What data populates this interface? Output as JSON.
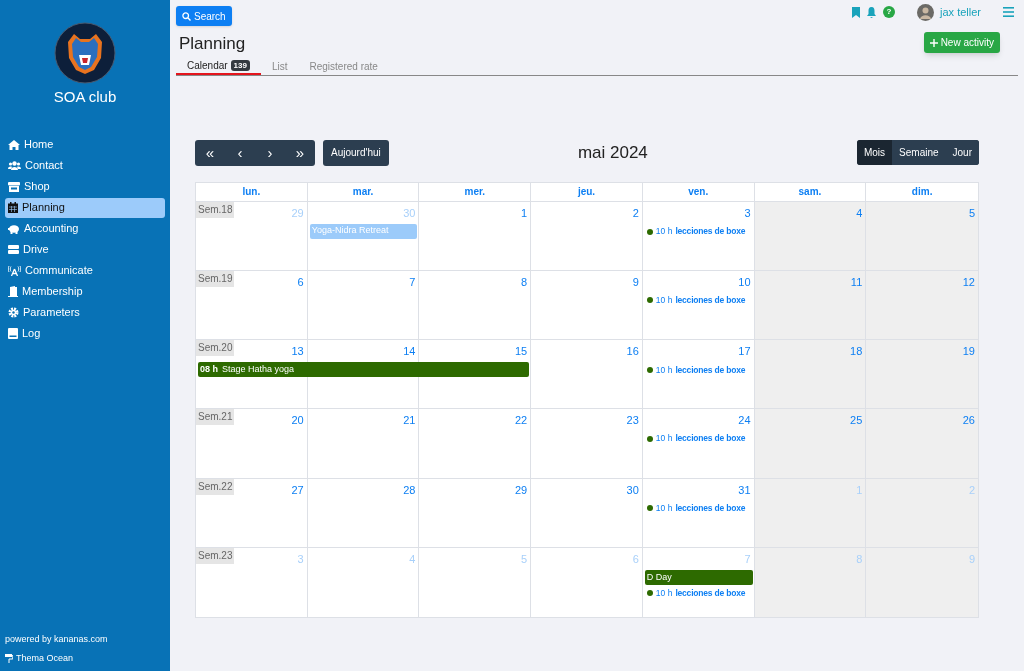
{
  "sidebar": {
    "club_name": "SOA club",
    "items": [
      {
        "label": "Home",
        "selected": false
      },
      {
        "label": "Contact",
        "selected": false
      },
      {
        "label": "Shop",
        "selected": false
      },
      {
        "label": "Planning",
        "selected": true
      },
      {
        "label": "Accounting",
        "selected": false
      },
      {
        "label": "Drive",
        "selected": false
      },
      {
        "label": "Communicate",
        "selected": false
      },
      {
        "label": "Membership",
        "selected": false
      },
      {
        "label": "Parameters",
        "selected": false
      },
      {
        "label": "Log",
        "selected": false
      }
    ],
    "powered_by": "powered by kananas.com",
    "theme": "Thema Ocean"
  },
  "topbar": {
    "search_label": "Search",
    "user_name": "jax teller",
    "help": "?"
  },
  "page_title": "Planning",
  "new_activity_label": "New activity",
  "tabs": [
    {
      "label": "Calendar",
      "badge": "139",
      "selected": true
    },
    {
      "label": "List",
      "selected": false
    },
    {
      "label": "Registered rate",
      "selected": false
    }
  ],
  "calendar": {
    "nav_buttons": [
      "«",
      "‹",
      "›",
      "»"
    ],
    "today_label": "Aujourd'hui",
    "title": "mai 2024",
    "views": [
      {
        "label": "Mois",
        "selected": true
      },
      {
        "label": "Semaine",
        "selected": false
      },
      {
        "label": "Jour",
        "selected": false
      }
    ],
    "weekdays": [
      "lun.",
      "mar.",
      "mer.",
      "jeu.",
      "ven.",
      "sam.",
      "dim."
    ],
    "weeks": [
      {
        "label": "Sem.18",
        "days": [
          {
            "day": "29",
            "other_month": true
          },
          {
            "day": "30",
            "other_month": true,
            "events": [
              {
                "kind": "bar",
                "title": "Yoga-Nidra Retreat",
                "color": "#9ccbfa"
              }
            ]
          },
          {
            "day": "1",
            "other_month": false
          },
          {
            "day": "2",
            "other_month": false
          },
          {
            "day": "3",
            "other_month": false,
            "events": [
              {
                "kind": "dot",
                "time": "10 h",
                "title": "lecciones de boxe",
                "color": "#2d6a00"
              }
            ]
          },
          {
            "day": "4",
            "other_month": false
          },
          {
            "day": "5",
            "other_month": false
          }
        ]
      },
      {
        "label": "Sem.19",
        "days": [
          {
            "day": "6",
            "other_month": false
          },
          {
            "day": "7",
            "other_month": false
          },
          {
            "day": "8",
            "other_month": false
          },
          {
            "day": "9",
            "other_month": false
          },
          {
            "day": "10",
            "other_month": false,
            "events": [
              {
                "kind": "dot",
                "time": "10 h",
                "title": "lecciones de boxe",
                "color": "#2d6a00"
              }
            ]
          },
          {
            "day": "11",
            "other_month": false
          },
          {
            "day": "12",
            "other_month": false
          }
        ]
      },
      {
        "label": "Sem.20",
        "days": [
          {
            "day": "13",
            "other_month": false,
            "events": [
              {
                "kind": "bar",
                "time": "08 h",
                "title": "Stage Hatha yoga",
                "color": "#2d6a00"
              }
            ]
          },
          {
            "day": "14",
            "other_month": false,
            "events": [
              {
                "kind": "continued"
              }
            ]
          },
          {
            "day": "15",
            "other_month": false,
            "events": [
              {
                "kind": "continued"
              }
            ]
          },
          {
            "day": "16",
            "other_month": false
          },
          {
            "day": "17",
            "other_month": false,
            "events": [
              {
                "kind": "dot",
                "time": "10 h",
                "title": "lecciones de boxe",
                "color": "#2d6a00"
              }
            ]
          },
          {
            "day": "18",
            "other_month": false
          },
          {
            "day": "19",
            "other_month": false
          }
        ]
      },
      {
        "label": "Sem.21",
        "days": [
          {
            "day": "20",
            "other_month": false
          },
          {
            "day": "21",
            "other_month": false
          },
          {
            "day": "22",
            "other_month": false
          },
          {
            "day": "23",
            "other_month": false
          },
          {
            "day": "24",
            "other_month": false,
            "events": [
              {
                "kind": "dot",
                "time": "10 h",
                "title": "lecciones de boxe",
                "color": "#2d6a00"
              }
            ]
          },
          {
            "day": "25",
            "other_month": false
          },
          {
            "day": "26",
            "other_month": false
          }
        ]
      },
      {
        "label": "Sem.22",
        "days": [
          {
            "day": "27",
            "other_month": false
          },
          {
            "day": "28",
            "other_month": false
          },
          {
            "day": "29",
            "other_month": false
          },
          {
            "day": "30",
            "other_month": false
          },
          {
            "day": "31",
            "other_month": false,
            "events": [
              {
                "kind": "dot",
                "time": "10 h",
                "title": "lecciones de boxe",
                "color": "#2d6a00"
              }
            ]
          },
          {
            "day": "1",
            "other_month": true
          },
          {
            "day": "2",
            "other_month": true
          }
        ]
      },
      {
        "label": "Sem.23",
        "days": [
          {
            "day": "3",
            "other_month": true
          },
          {
            "day": "4",
            "other_month": true
          },
          {
            "day": "5",
            "other_month": true
          },
          {
            "day": "6",
            "other_month": true
          },
          {
            "day": "7",
            "other_month": true,
            "events": [
              {
                "kind": "bar",
                "title": "D Day",
                "color": "#2d6a00"
              },
              {
                "kind": "dot",
                "time": "10 h",
                "title": "lecciones de boxe",
                "color": "#2d6a00"
              }
            ]
          },
          {
            "day": "8",
            "other_month": true
          },
          {
            "day": "9",
            "other_month": true
          }
        ]
      }
    ]
  }
}
